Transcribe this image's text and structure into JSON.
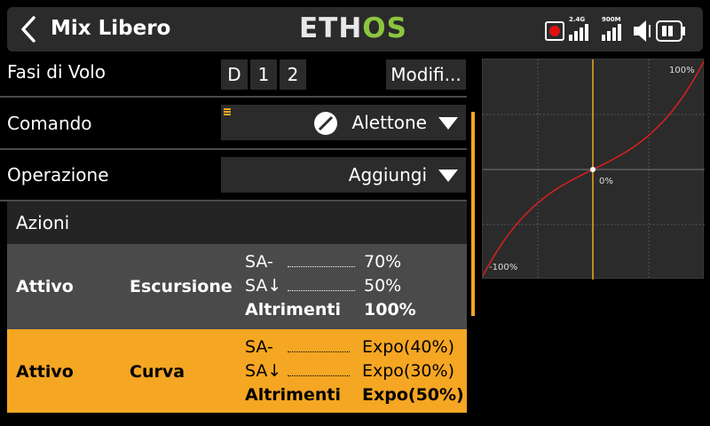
{
  "header": {
    "title": "Mix Libero",
    "logo_part1": "ETH",
    "logo_part2": "OS",
    "status": {
      "band1": "2.4G",
      "band2": "900M"
    }
  },
  "flight_modes": {
    "label": "Fasi di Volo",
    "modes": [
      "D",
      "1",
      "2"
    ],
    "modify_label": "Modifi..."
  },
  "command": {
    "label": "Comando",
    "value": "Alettone"
  },
  "operation": {
    "label": "Operazione",
    "value": "Aggiungi"
  },
  "actions": {
    "title": "Azioni",
    "rows": [
      {
        "state": "Attivo",
        "kind": "Escursione",
        "conditions": [
          {
            "switch": "SA-",
            "value": "70%"
          },
          {
            "switch": "SA↓",
            "value": "50%"
          },
          {
            "switch": "Altrimenti",
            "value": "100%"
          }
        ]
      },
      {
        "state": "Attivo",
        "kind": "Curva",
        "conditions": [
          {
            "switch": "SA-",
            "value": "Expo(40%)"
          },
          {
            "switch": "SA↓",
            "value": "Expo(30%)"
          },
          {
            "switch": "Altrimenti",
            "value": "Expo(50%)"
          }
        ]
      }
    ]
  },
  "graph": {
    "label_top": "100%",
    "label_center": "0%",
    "label_bottom": "-100%",
    "curve_color": "#d92020",
    "cursor_color": "#f5a623",
    "expo": 0.5
  }
}
